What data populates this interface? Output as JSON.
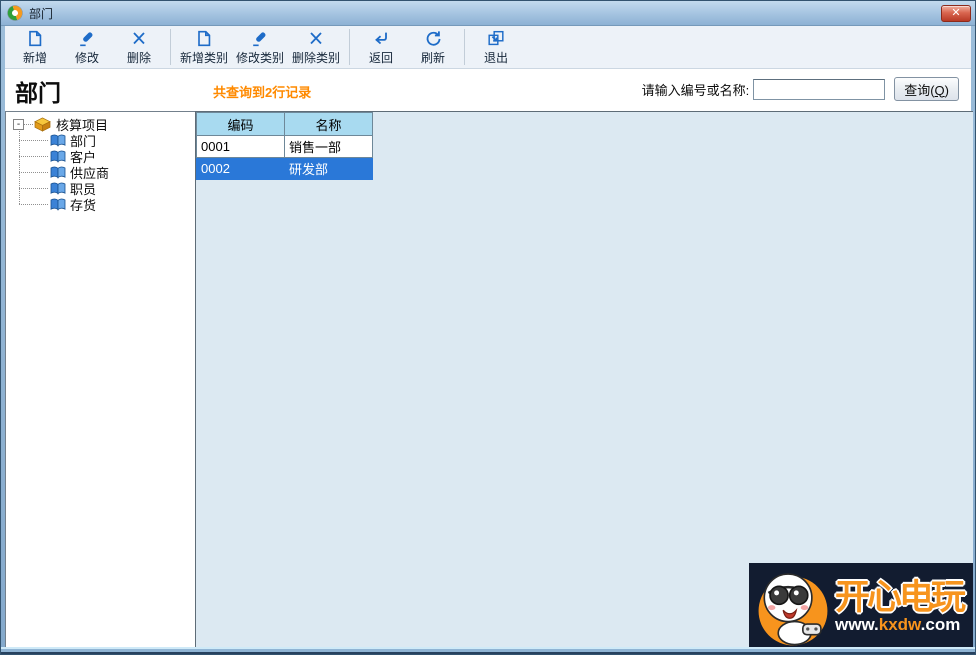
{
  "colors": {
    "selection_blue": "#2a78d8",
    "table_header_blue": "#a8daf0",
    "accent_orange": "#ff8a00",
    "toolbar_icon_blue": "#1e6cc8",
    "content_bg": "#dce9f2",
    "watermark_bg": "#121c30",
    "watermark_orange": "#f7941d"
  },
  "titlebar": {
    "title": "部门",
    "close_glyph": "✕"
  },
  "toolbar": {
    "buttons": [
      {
        "label": "新增",
        "icon": "new-doc-icon"
      },
      {
        "label": "修改",
        "icon": "edit-icon"
      },
      {
        "label": "删除",
        "icon": "delete-icon"
      },
      {
        "label": "新增类别",
        "icon": "new-category-icon"
      },
      {
        "label": "修改类别",
        "icon": "edit-category-icon"
      },
      {
        "label": "删除类别",
        "icon": "delete-category-icon"
      },
      {
        "label": "返回",
        "icon": "back-icon"
      },
      {
        "label": "刷新",
        "icon": "refresh-icon"
      },
      {
        "label": "退出",
        "icon": "exit-icon"
      }
    ]
  },
  "header": {
    "title": "部门",
    "record_count": "共查询到2行记录",
    "search_label": "请输入编号或名称:",
    "search_value": "",
    "query_button": {
      "pre": "查询(",
      "key": "Q",
      "post": ")"
    }
  },
  "tree": {
    "expand_glyph": "-",
    "root_label": "核算项目",
    "items": [
      {
        "label": "部门"
      },
      {
        "label": "客户"
      },
      {
        "label": "供应商"
      },
      {
        "label": "职员"
      },
      {
        "label": "存货"
      }
    ]
  },
  "table": {
    "columns": [
      {
        "label": "编码"
      },
      {
        "label": "名称"
      }
    ],
    "rows": [
      {
        "code": "0001",
        "name": "销售一部",
        "selected": false
      },
      {
        "code": "0002",
        "name": "研发部",
        "selected": true
      }
    ]
  },
  "watermark": {
    "brand": "开心电玩",
    "url_www": "www.",
    "url_domain": "kxdw",
    "url_tld": ".com"
  }
}
